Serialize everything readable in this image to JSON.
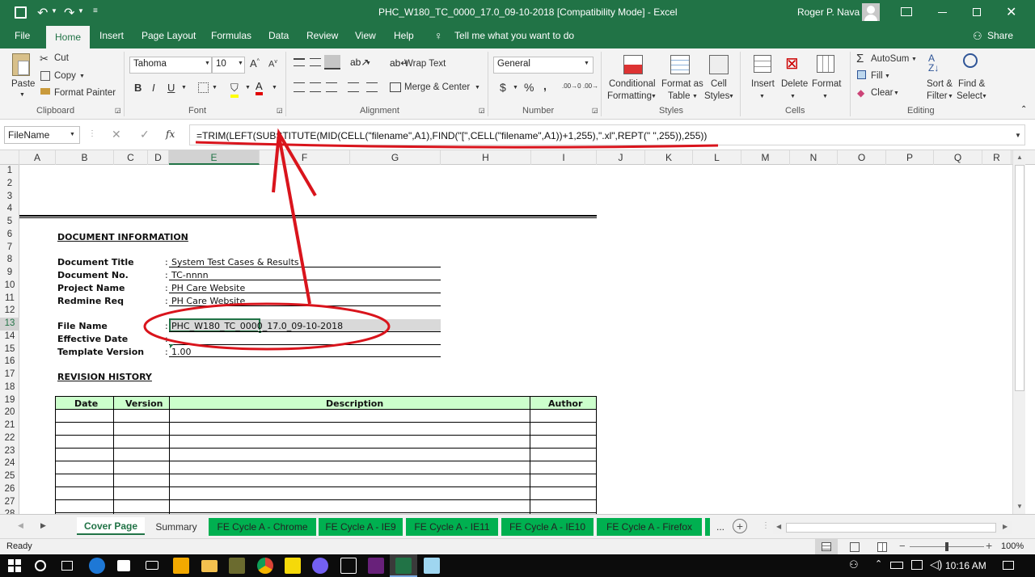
{
  "window": {
    "title": "PHC_W180_TC_0000_17.0_09-10-2018  [Compatibility Mode]  -  Excel",
    "user": "Roger P. Nava"
  },
  "ribbon_tabs": [
    "File",
    "Home",
    "Insert",
    "Page Layout",
    "Formulas",
    "Data",
    "Review",
    "View",
    "Help"
  ],
  "tell_me": "Tell me what you want to do",
  "share": "Share",
  "clipboard": {
    "paste": "Paste",
    "cut": "Cut",
    "copy": "Copy",
    "format_painter": "Format Painter",
    "group": "Clipboard"
  },
  "font": {
    "name": "Tahoma",
    "size": "10",
    "group": "Font"
  },
  "alignment": {
    "wrap": "Wrap Text",
    "merge": "Merge & Center",
    "group": "Alignment"
  },
  "number": {
    "format": "General",
    "group": "Number",
    "currency": "$",
    "percent": "%",
    "comma": ","
  },
  "styles": {
    "conditional_1": "Conditional",
    "conditional_2": "Formatting",
    "format_as_1": "Format as",
    "format_as_2": "Table",
    "cell_styles_1": "Cell",
    "cell_styles_2": "Styles",
    "group": "Styles"
  },
  "cells": {
    "insert": "Insert",
    "delete": "Delete",
    "format": "Format",
    "group": "Cells"
  },
  "editing": {
    "autosum": "AutoSum",
    "fill": "Fill",
    "clear": "Clear",
    "sort_1": "Sort &",
    "sort_2": "Filter",
    "find_1": "Find &",
    "find_2": "Select",
    "group": "Editing"
  },
  "formula_bar": {
    "name_box": "FileName",
    "fx": "fx",
    "formula": "=TRIM(LEFT(SUBSTITUTE(MID(CELL(\"filename\",A1),FIND(\"[\",CELL(\"filename\",A1))+1,255),\".xl\",REPT(\" \",255)),255))"
  },
  "columns": [
    "A",
    "B",
    "C",
    "D",
    "E",
    "F",
    "G",
    "H",
    "I",
    "J",
    "K",
    "L",
    "M",
    "N",
    "O",
    "P",
    "Q",
    "R"
  ],
  "rows": [
    "1",
    "2",
    "3",
    "4",
    "5",
    "6",
    "7",
    "8",
    "9",
    "10",
    "11",
    "12",
    "13",
    "14",
    "15",
    "16",
    "17",
    "18",
    "19",
    "20",
    "21",
    "22",
    "23",
    "24",
    "25",
    "26",
    "27",
    "28"
  ],
  "sheet": {
    "doc_info_heading": "DOCUMENT INFORMATION",
    "doc_title_label": "Document Title",
    "doc_title_value": "System Test Cases & Results",
    "doc_no_label": "Document No.",
    "doc_no_value": "TC-nnnn",
    "project_label": "Project Name",
    "project_value": "PH Care Website",
    "redmine_label": "Redmine Req",
    "redmine_value": "PH Care Website",
    "file_name_label": "File Name",
    "file_name_value": "PHC_W180_TC_0000_17.0_09-10-2018",
    "effective_label": "Effective Date",
    "template_label": "Template Version",
    "template_value": "1.00",
    "colon": ":",
    "revision_heading": "REVISION HISTORY",
    "rev_headers": [
      "Date",
      "Version",
      "Description",
      "Author"
    ]
  },
  "sheet_tabs": [
    "Cover Page",
    "Summary",
    "FE Cycle A - Chrome",
    "FE Cycle A - IE9",
    "FE Cycle A - IE11",
    "FE Cycle A - IE10",
    "FE Cycle A - Firefox"
  ],
  "more_tabs": "...",
  "status": {
    "ready": "Ready",
    "zoom": "100%",
    "zoom_level": 1.0
  },
  "taskbar": {
    "time": "10:16 AM"
  },
  "colors": {
    "excel_green": "#217346",
    "tab_green": "#00b050",
    "header_fill": "#ccffcc",
    "annotation_red": "#d9141c"
  }
}
